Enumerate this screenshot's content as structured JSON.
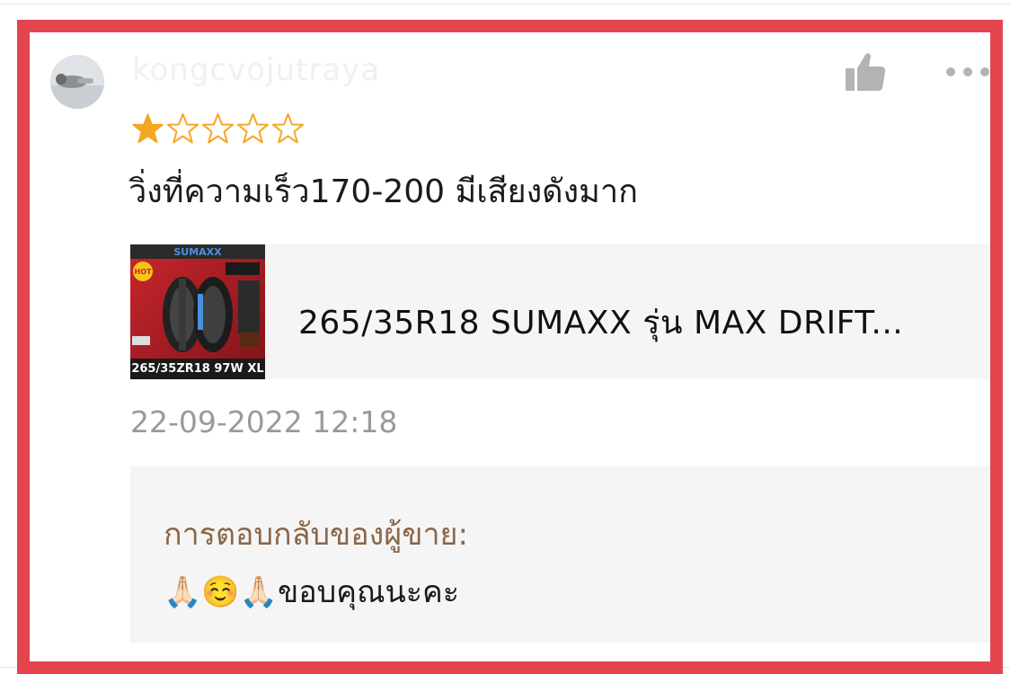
{
  "review": {
    "username": "kongcvojutraya",
    "rating": 1,
    "max_rating": 5,
    "text": "วิ่งที่ความเร็ว170-200 มีเสียงดังมาก",
    "timestamp": "22-09-2022 12:18"
  },
  "product": {
    "name": "265/35R18 SUMAXX รุ่น MAX DRIFT...",
    "thumb_brand": "SUMAXX",
    "thumb_badge": "HOT",
    "thumb_caption": "265/35ZR18 97W XL"
  },
  "seller_reply": {
    "label": "การตอบกลับของผู้ขาย:",
    "text": "🙏🏻☺️🙏🏻ขอบคุณนะคะ"
  },
  "icons": {
    "like": "thumbs-up-icon",
    "more": "more-dots-icon",
    "star_filled": "star-filled-icon",
    "star_empty": "star-outline-icon"
  },
  "colors": {
    "frame": "#e4454d",
    "star": "#f6a623",
    "seller_label": "#8a6749",
    "timestamp": "#9a9a9a",
    "icon_gray": "#b3b3b3"
  }
}
